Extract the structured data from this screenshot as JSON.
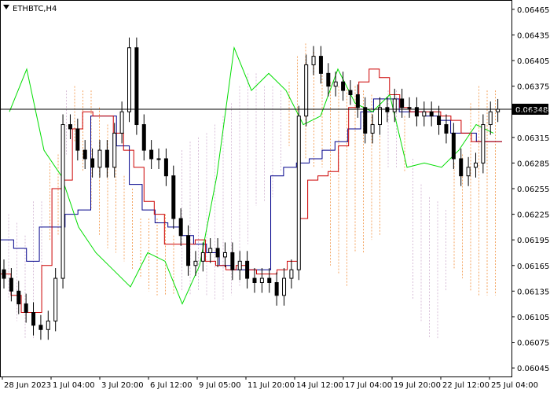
{
  "header": {
    "symbol": "ETHBTC,H4"
  },
  "chart_data": {
    "type": "candlestick",
    "symbol": "ETHBTC",
    "timeframe": "H4",
    "current_price": "0.06348",
    "ylim": [
      0.06035,
      0.06475
    ],
    "y_ticks": [
      "0.06465",
      "0.06435",
      "0.06405",
      "0.06375",
      "0.06345",
      "0.06315",
      "0.06285",
      "0.06255",
      "0.06225",
      "0.06195",
      "0.06165",
      "0.06135",
      "0.06105",
      "0.06075",
      "0.06045"
    ],
    "x_ticks": [
      "28 Jun 2023",
      "1 Jul 04:00",
      "3 Jul 20:00",
      "6 Jul 12:00",
      "9 Jul 05:00",
      "11 Jul 20:00",
      "14 Jul 12:00",
      "17 Jul 04:00",
      "19 Jul 20:00",
      "22 Jul 12:00",
      "25 Jul 04:00"
    ],
    "colors": {
      "tenkan": "#cc0000",
      "kijun": "#00008b",
      "chikou": "#00dd00",
      "kumo_up": "#f4a460",
      "kumo_down": "#d8bfd8",
      "candle": "#000000",
      "price_line": "#000000"
    },
    "candles_close": [
      0.0615,
      0.06135,
      0.0612,
      0.0611,
      0.06095,
      0.0609,
      0.061,
      0.0615,
      0.0633,
      0.06325,
      0.063,
      0.0629,
      0.0628,
      0.063,
      0.0628,
      0.0632,
      0.06345,
      0.0642,
      0.0633,
      0.063,
      0.0629,
      0.0629,
      0.0627,
      0.0622,
      0.062,
      0.06165,
      0.0617,
      0.0618,
      0.06185,
      0.06175,
      0.0618,
      0.0616,
      0.0617,
      0.0615,
      0.06145,
      0.0615,
      0.06145,
      0.0613,
      0.0615,
      0.0616,
      0.0634,
      0.064,
      0.0641,
      0.0639,
      0.06375,
      0.0638,
      0.0637,
      0.06365,
      0.0635,
      0.0632,
      0.0633,
      0.0635,
      0.06345,
      0.0636,
      0.0635,
      0.0635,
      0.0634,
      0.06345,
      0.0634,
      0.0633,
      0.0632,
      0.0629,
      0.0627,
      0.0628,
      0.06285,
      0.0633,
      0.06345,
      0.06348
    ],
    "tenkan": [
      0.06155,
      0.0613,
      0.0611,
      0.0611,
      0.06165,
      0.06255,
      0.06265,
      0.06325,
      0.06345,
      0.0634,
      0.0634,
      0.0632,
      0.063,
      0.0628,
      0.0624,
      0.06225,
      0.0619,
      0.0619,
      0.0619,
      0.06195,
      0.0617,
      0.06165,
      0.0616,
      0.06165,
      0.0616,
      0.06155,
      0.06155,
      0.0616,
      0.0617,
      0.0622,
      0.06265,
      0.0627,
      0.06275,
      0.06305,
      0.0635,
      0.0638,
      0.06395,
      0.06385,
      0.06365,
      0.0635,
      0.06345,
      0.06345,
      0.06345,
      0.0634,
      0.06335,
      0.0632,
      0.0631,
      0.0631,
      0.0631
    ],
    "kijun": [
      0.06195,
      0.06185,
      0.0617,
      0.0621,
      0.0621,
      0.06225,
      0.0623,
      0.0634,
      0.0634,
      0.06305,
      0.0626,
      0.0623,
      0.06215,
      0.0621,
      0.062,
      0.0619,
      0.0618,
      0.06165,
      0.0616,
      0.0616,
      0.0616,
      0.0627,
      0.0628,
      0.06285,
      0.0629,
      0.063,
      0.0631,
      0.06325,
      0.06345,
      0.0636,
      0.0636,
      0.06345,
      0.06345,
      0.0634,
      0.06335,
      0.0632,
      0.0632,
      0.0631,
      0.0631
    ],
    "chikou": [
      0.06345,
      0.06395,
      0.063,
      0.0627,
      0.0621,
      0.0618,
      0.0616,
      0.0614,
      0.0618,
      0.0617,
      0.0612,
      0.06165,
      0.0627,
      0.0642,
      0.0637,
      0.0639,
      0.0637,
      0.0633,
      0.0634,
      0.06395,
      0.06355,
      0.06345,
      0.06365,
      0.0628,
      0.06285,
      0.0628,
      0.063,
      0.0633,
      0.0632
    ]
  }
}
